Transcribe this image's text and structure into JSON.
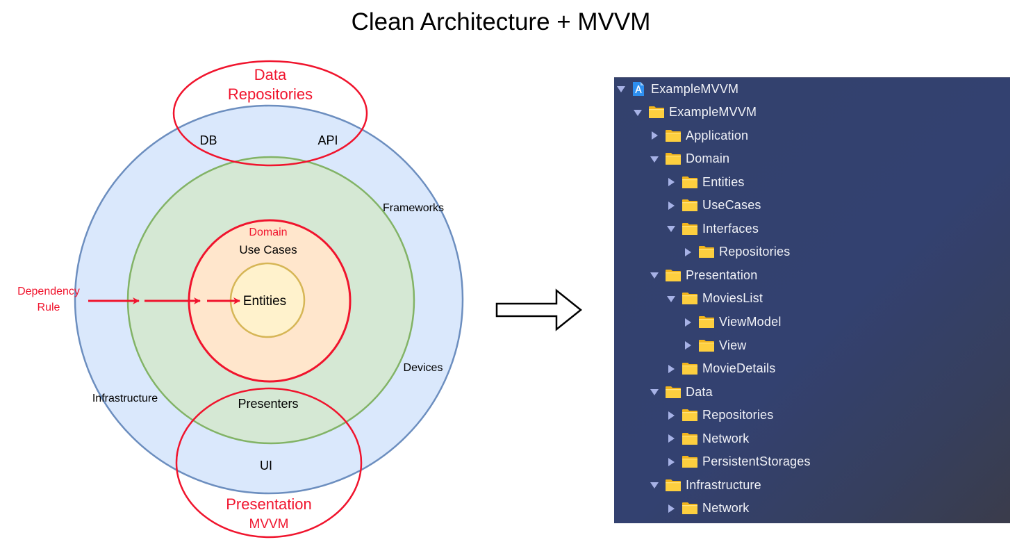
{
  "title": "Clean Architecture + MVVM",
  "diagram": {
    "layers": [
      {
        "id": "infrastructure",
        "fill": "#dae8fc",
        "stroke": "#6c8ebf",
        "labels": [
          "DB",
          "API",
          "Frameworks",
          "Devices",
          "Infrastructure",
          "UI"
        ]
      },
      {
        "id": "presenters",
        "fill": "#d5e8d4",
        "stroke": "#82b366",
        "labels": [
          "Presenters"
        ]
      },
      {
        "id": "use-cases",
        "fill": "#ffe6cc",
        "stroke": "#f0142d",
        "labels": [
          "Domain",
          "Use Cases"
        ]
      },
      {
        "id": "entities",
        "fill": "#fff2cc",
        "stroke": "#d6b656",
        "labels": [
          "Entities"
        ]
      }
    ],
    "labels": {
      "db": "DB",
      "api": "API",
      "frameworks": "Frameworks",
      "devices": "Devices",
      "infrastructure": "Infrastructure",
      "ui": "UI",
      "presenters": "Presenters",
      "domain": "Domain",
      "use_cases": "Use Cases",
      "entities": "Entities"
    },
    "callouts": {
      "data_line1": "Data",
      "data_line2": "Repositories",
      "presentation_line1": "Presentation",
      "presentation_line2": "MVVM",
      "dependency_line1": "Dependency",
      "dependency_line2": "Rule"
    },
    "accent_red": "#f0142d"
  },
  "arrow": {
    "icon": "right-arrow-icon"
  },
  "tree": {
    "root_icon": "xcode-project-icon",
    "folder_icon": "folder-icon",
    "items": [
      {
        "label": "ExampleMVVM",
        "level": 0,
        "expanded": true,
        "icon": "project"
      },
      {
        "label": "ExampleMVVM",
        "level": 1,
        "expanded": true,
        "icon": "folder"
      },
      {
        "label": "Application",
        "level": 2,
        "expanded": false,
        "icon": "folder"
      },
      {
        "label": "Domain",
        "level": 2,
        "expanded": true,
        "icon": "folder"
      },
      {
        "label": "Entities",
        "level": 3,
        "expanded": false,
        "icon": "folder"
      },
      {
        "label": "UseCases",
        "level": 3,
        "expanded": false,
        "icon": "folder"
      },
      {
        "label": "Interfaces",
        "level": 3,
        "expanded": true,
        "icon": "folder"
      },
      {
        "label": "Repositories",
        "level": 4,
        "expanded": false,
        "icon": "folder"
      },
      {
        "label": "Presentation",
        "level": 2,
        "expanded": true,
        "icon": "folder"
      },
      {
        "label": "MoviesList",
        "level": 3,
        "expanded": true,
        "icon": "folder"
      },
      {
        "label": "ViewModel",
        "level": 4,
        "expanded": false,
        "icon": "folder"
      },
      {
        "label": "View",
        "level": 4,
        "expanded": false,
        "icon": "folder"
      },
      {
        "label": "MovieDetails",
        "level": 3,
        "expanded": false,
        "icon": "folder"
      },
      {
        "label": "Data",
        "level": 2,
        "expanded": true,
        "icon": "folder"
      },
      {
        "label": "Repositories",
        "level": 3,
        "expanded": false,
        "icon": "folder"
      },
      {
        "label": "Network",
        "level": 3,
        "expanded": false,
        "icon": "folder"
      },
      {
        "label": "PersistentStorages",
        "level": 3,
        "expanded": false,
        "icon": "folder"
      },
      {
        "label": "Infrastructure",
        "level": 2,
        "expanded": true,
        "icon": "folder"
      },
      {
        "label": "Network",
        "level": 3,
        "expanded": false,
        "icon": "folder"
      }
    ]
  }
}
